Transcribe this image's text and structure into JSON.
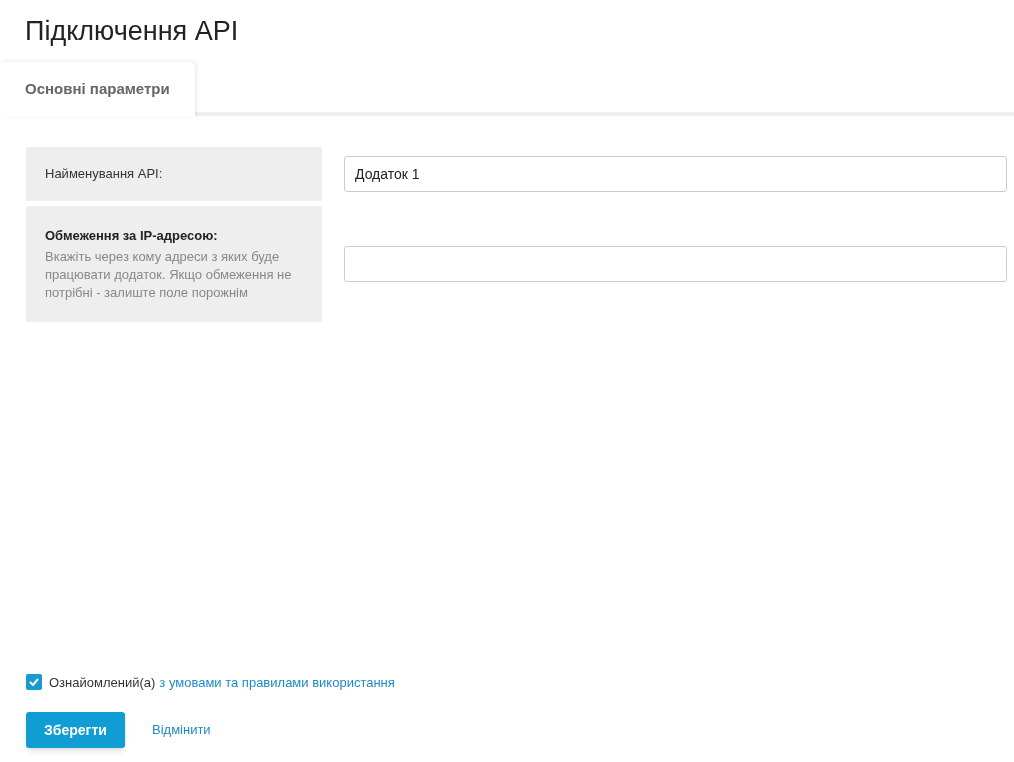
{
  "page": {
    "title": "Підключення API"
  },
  "tabs": [
    {
      "label": "Основні параметри",
      "selected": true
    }
  ],
  "fields": [
    {
      "label": "Найменування API:",
      "value": "Додаток 1"
    },
    {
      "label": "Обмеження за IP-адресою:",
      "hint": "Вкажіть через кому адреси з яких буде працювати додаток. Якщо обмеження не потрібні - залиште поле порожнім"
    }
  ],
  "agreement": {
    "checked": true,
    "text": "Ознайомлений(а)",
    "link": "з умовами та правилами використання"
  },
  "buttons": {
    "save": "Зберегти",
    "cancel": "Відмінити"
  }
}
